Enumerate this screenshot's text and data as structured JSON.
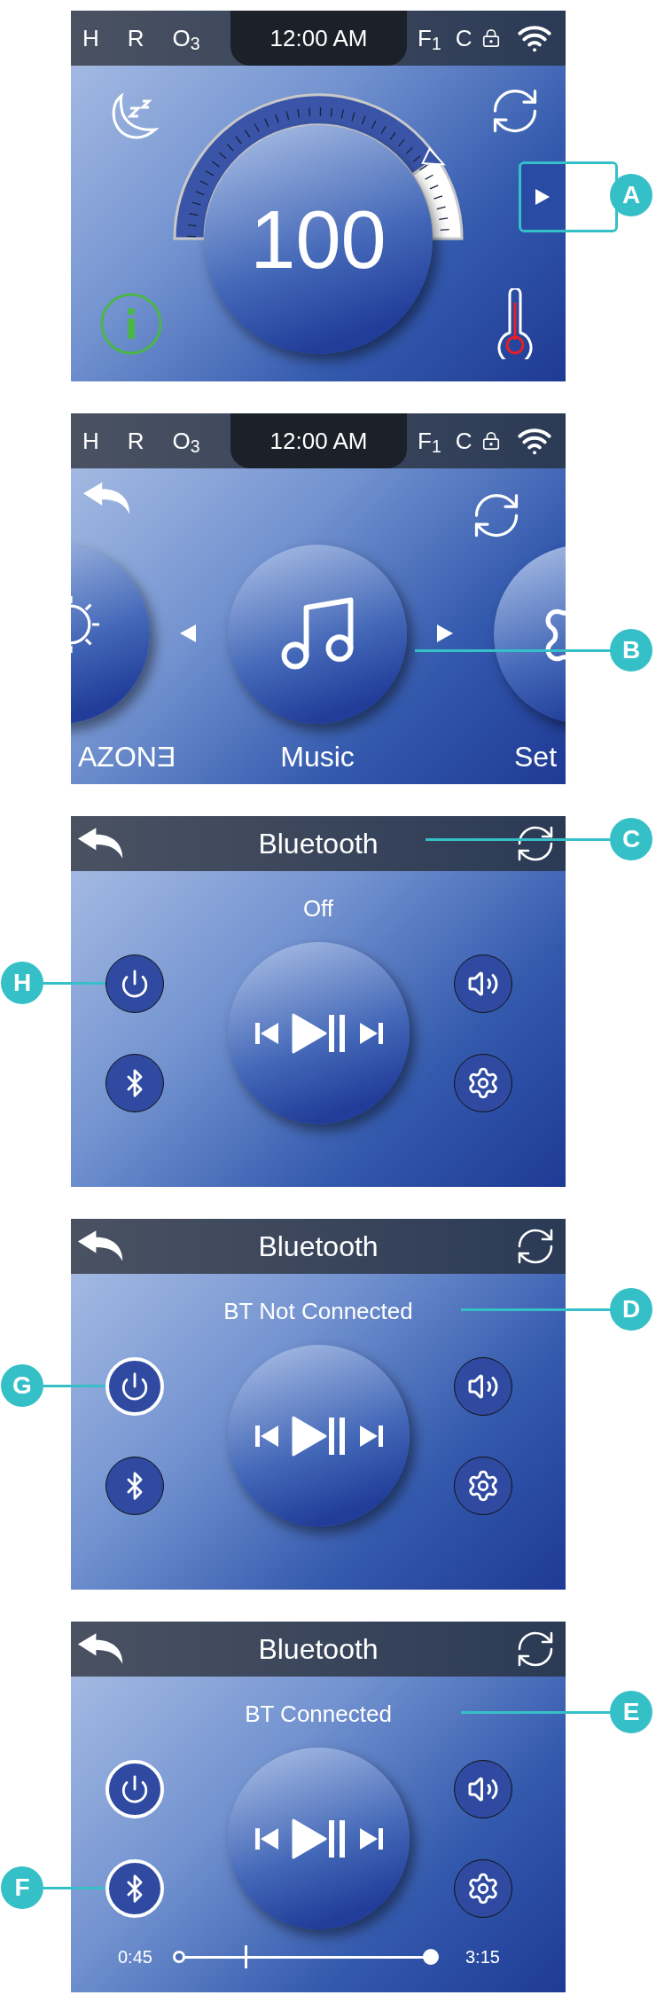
{
  "screens": [
    {
      "kind": "home",
      "status_bar": {
        "left": [
          "H",
          "R",
          "O$_{3}$"
        ],
        "time": "12:00 AM",
        "right": [
          "F$_{1}$",
          "C"
        ]
      },
      "temperature": "100",
      "callouts": [
        {
          "letter": "A",
          "kind": "play-tab"
        }
      ]
    },
    {
      "kind": "menu",
      "status_bar": {
        "left": [
          "H",
          "R",
          "O$_{3}$"
        ],
        "time": "12:00 AM",
        "right": [
          "F$_{1}$",
          "C"
        ]
      },
      "carousel": [
        {
          "label": "AZONƎ",
          "kind": "ozone"
        },
        {
          "label": "Music",
          "kind": "music"
        },
        {
          "label": "Set",
          "kind": "settings"
        }
      ],
      "callouts": [
        {
          "letter": "B",
          "kind": "carousel"
        }
      ]
    },
    {
      "kind": "bluetooth",
      "title": "Bluetooth",
      "status": "Off",
      "buttons": [
        {
          "kind": "power",
          "active": false
        },
        {
          "kind": "bluetooth",
          "active": false
        },
        {
          "kind": "volume",
          "active": false
        },
        {
          "kind": "settings",
          "active": false
        }
      ],
      "callouts": [
        {
          "letter": "C",
          "kind": "title"
        },
        {
          "letter": "H",
          "kind": "power"
        }
      ]
    },
    {
      "kind": "bluetooth",
      "title": "Bluetooth",
      "status": "BT Not Connected",
      "buttons": [
        {
          "kind": "power",
          "active": true
        },
        {
          "kind": "bluetooth",
          "active": false
        },
        {
          "kind": "volume",
          "active": false
        },
        {
          "kind": "settings",
          "active": false
        }
      ],
      "callouts": [
        {
          "letter": "D",
          "kind": "status"
        },
        {
          "letter": "G",
          "kind": "power"
        }
      ]
    },
    {
      "kind": "bluetooth",
      "title": "Bluetooth",
      "status": "BT Connected",
      "buttons": [
        {
          "kind": "power",
          "active": true
        },
        {
          "kind": "bluetooth",
          "active": true
        },
        {
          "kind": "volume",
          "active": false
        },
        {
          "kind": "settings",
          "active": false
        }
      ],
      "progress": {
        "elapsed": "0:45",
        "total": "3:15",
        "level": 0.27
      },
      "callouts": [
        {
          "letter": "E",
          "kind": "status"
        },
        {
          "letter": "F",
          "kind": "bluetooth"
        }
      ]
    }
  ]
}
